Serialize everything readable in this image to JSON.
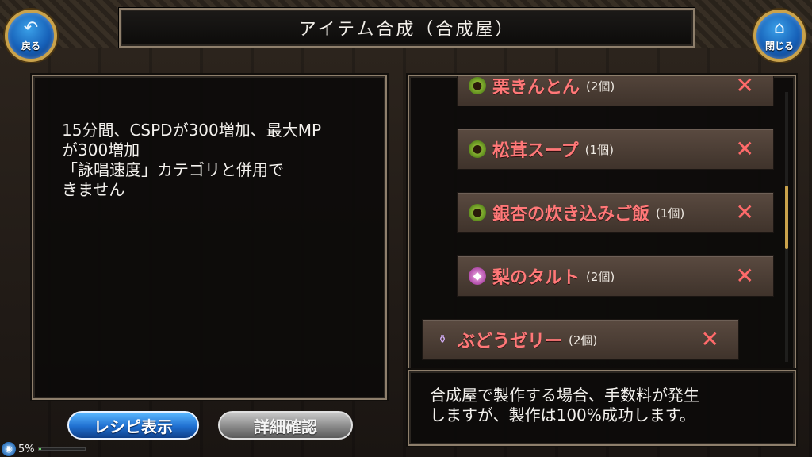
{
  "header": {
    "title": "アイテム合成（合成屋）",
    "back_label": "戻る",
    "close_label": "閉じる"
  },
  "description": {
    "text": "15分間、CSPDが300増加、最大MP\nが300増加\n「詠唱速度」カテゴリと併用で\nきません"
  },
  "ingredients": [
    {
      "name": "栗きんとん",
      "qty": "(2個)",
      "icon": "food-icon"
    },
    {
      "name": "松茸スープ",
      "qty": "(1個)",
      "icon": "food-icon"
    },
    {
      "name": "銀杏の炊き込みご飯",
      "qty": "(1個)",
      "icon": "food-icon"
    },
    {
      "name": "梨のタルト",
      "qty": "(2個)",
      "icon": "cake-icon"
    },
    {
      "name": "ぶどうゼリー",
      "qty": "(2個)",
      "icon": "potion-icon"
    }
  ],
  "remove_symbol": "✕",
  "info": {
    "text": "合成屋で製作する場合、手数料が発生\nしますが、製作は100%成功します。"
  },
  "buttons": {
    "recipe_label": "レシピ表示",
    "detail_label": "詳細確認"
  },
  "status": {
    "percent_label": "5%",
    "gauge_fraction": 0.05
  },
  "colors": {
    "item_name": "#ff7878",
    "accent_gold": "#c9a24b",
    "recipe_button": "#1f6fd0"
  }
}
